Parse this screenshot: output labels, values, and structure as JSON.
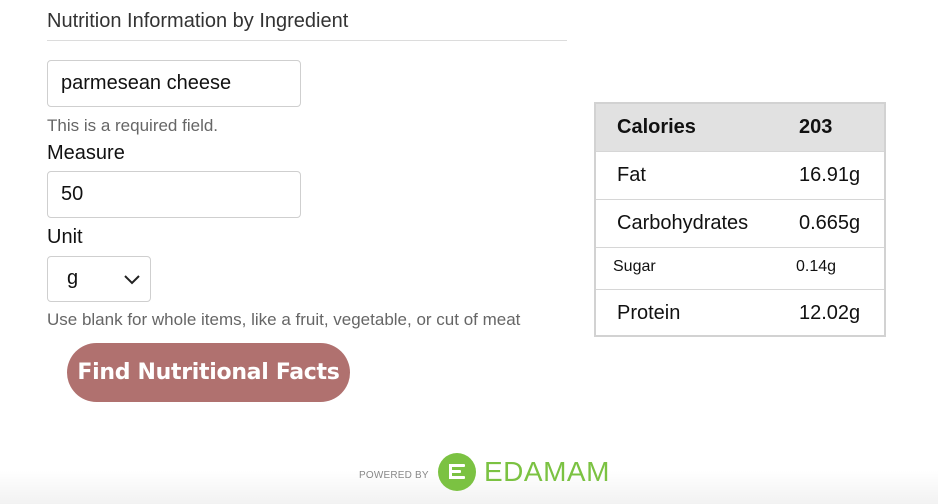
{
  "form": {
    "heading": "Nutrition Information by Ingredient",
    "ingredient_value": "parmesean cheese",
    "required_hint": "This is a required field.",
    "measure_label": "Measure",
    "measure_value": "50",
    "unit_label": "Unit",
    "unit_value": "g",
    "unit_hint": "Use blank for whole items, like a fruit, vegetable, or cut of meat",
    "submit_label": "Find Nutritional Facts"
  },
  "nutrition": {
    "header": {
      "label": "Calories",
      "value": "203"
    },
    "rows": [
      {
        "label": "Fat",
        "value": "16.91g"
      },
      {
        "label": "Carbohydrates",
        "value": "0.665g"
      },
      {
        "label": "Sugar",
        "value": "0.14g"
      },
      {
        "label": "Protein",
        "value": "12.02g"
      }
    ]
  },
  "footer": {
    "powered_by": "POWERED BY",
    "brand": "EDAMAM"
  },
  "colors": {
    "button": "#b0716f",
    "brand_green": "#7bc242",
    "table_header": "#e1e1e1"
  }
}
